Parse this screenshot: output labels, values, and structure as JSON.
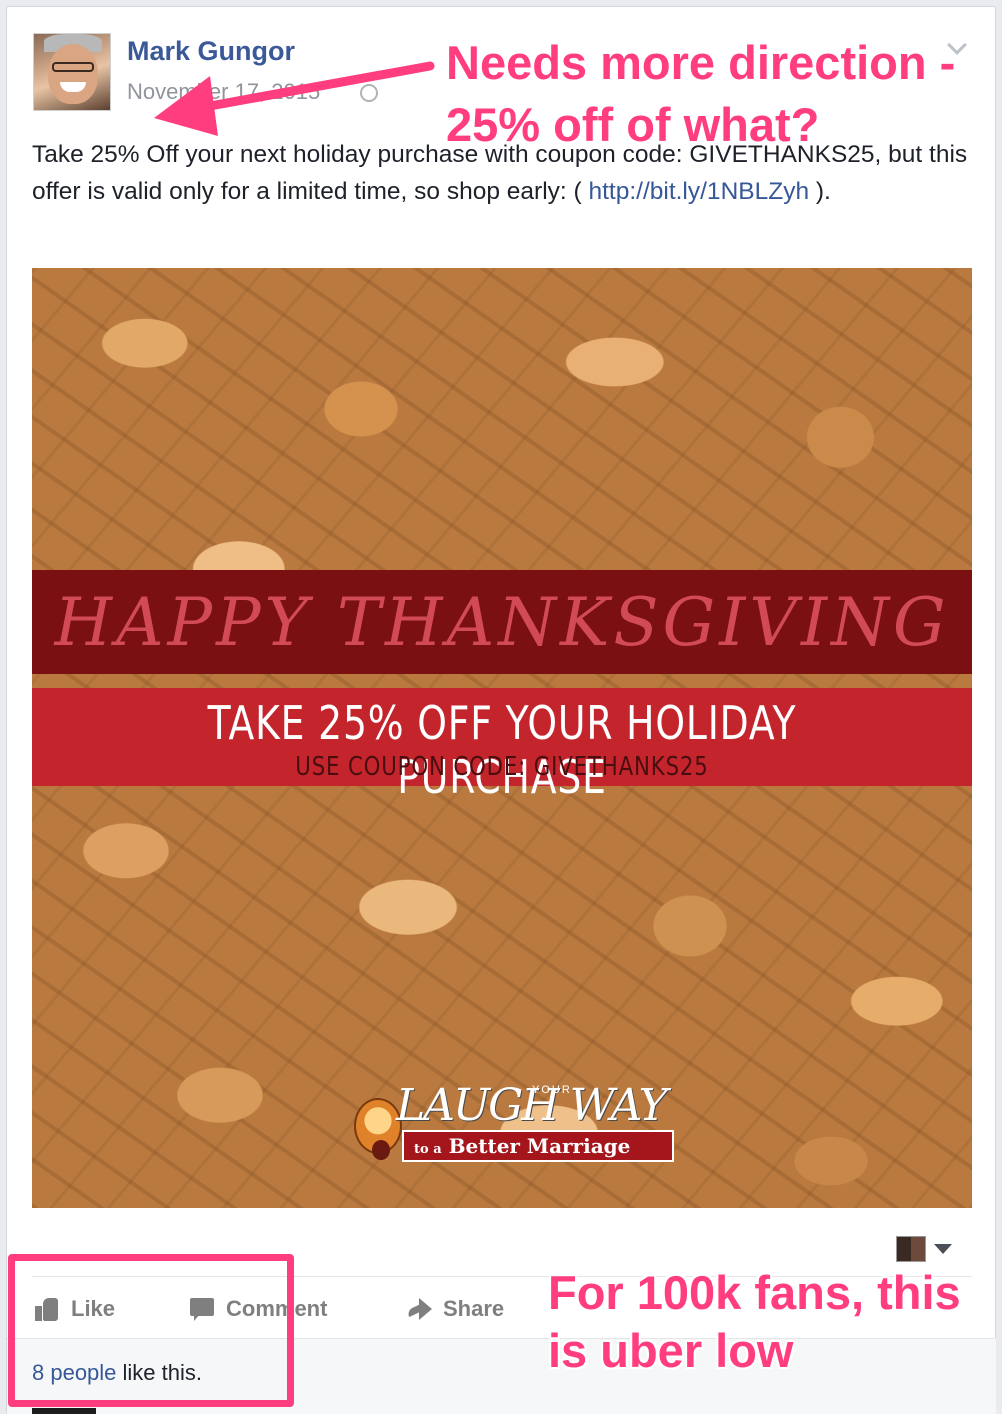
{
  "post": {
    "author": "Mark Gungor",
    "timestamp": "November 17, 2015",
    "text_before_link": "Take 25% Off your next holiday purchase with coupon code: GIVETHANKS25, but this offer is valid only for a limited time, so shop early: ( ",
    "link": "http://bit.ly/1NBLZyh",
    "text_after_link": " )."
  },
  "image": {
    "headline": "HAPPY THANKSGIVING",
    "subheadline": "TAKE 25% OFF YOUR HOLIDAY PURCHASE",
    "coupon_line": "USE COUPON CODE: GIVETHANKS25",
    "logo_word_main": "LAUGH",
    "logo_word_your": "YOUR",
    "logo_word_way": "WAY",
    "logo_tagline_small": "to a",
    "logo_tagline": "Better Marriage"
  },
  "actions": {
    "like": "Like",
    "comment": "Comment",
    "share": "Share"
  },
  "likes": {
    "link_text": "8 people",
    "suffix": " like this."
  },
  "annotations": {
    "top": "Needs more direction - 25% off of what?",
    "bottom": "For 100k fans, this is uber low"
  },
  "colors": {
    "annotation": "#ff3d7f",
    "link": "#365899",
    "author": "#3b5998"
  },
  "icons": [
    "globe-icon",
    "chevron-down-icon",
    "thumbs-up-icon",
    "comment-icon",
    "share-icon",
    "reaction-avatar"
  ]
}
